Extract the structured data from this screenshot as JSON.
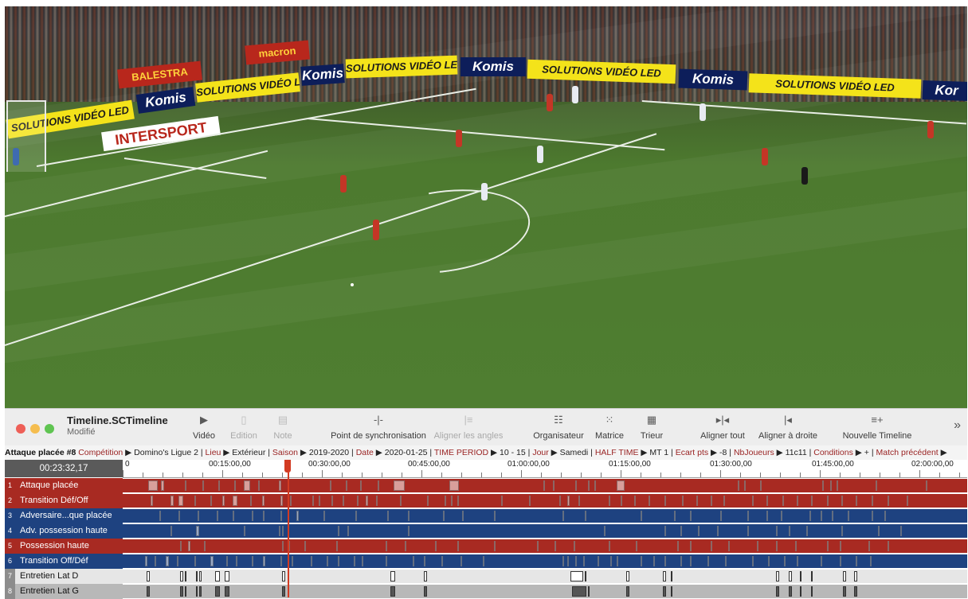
{
  "toolbar": {
    "title": "Timeline.SCTimeline",
    "subtitle": "Modifié",
    "tools": [
      {
        "label": "Vidéo",
        "icon": "video-icon",
        "glyph": "▶",
        "enabled": true
      },
      {
        "label": "Edition",
        "icon": "edit-icon",
        "glyph": "▯",
        "enabled": false
      },
      {
        "label": "Note",
        "icon": "note-icon",
        "glyph": "▤",
        "enabled": false
      },
      {
        "label": "Point de synchronisation",
        "icon": "sync-point-icon",
        "glyph": "-|-",
        "enabled": true
      },
      {
        "label": "Aligner les angles",
        "icon": "align-angles-icon",
        "glyph": "|≡",
        "enabled": false
      },
      {
        "label": "Organisateur",
        "icon": "organizer-icon",
        "glyph": "☷",
        "enabled": true
      },
      {
        "label": "Matrice",
        "icon": "matrix-icon",
        "glyph": "⁙",
        "enabled": true
      },
      {
        "label": "Trieur",
        "icon": "sorter-icon",
        "glyph": "▦",
        "enabled": true
      },
      {
        "label": "Aligner tout",
        "icon": "align-all-icon",
        "glyph": "▸|◂",
        "enabled": true
      },
      {
        "label": "Aligner à droite",
        "icon": "align-right-icon",
        "glyph": "|◂",
        "enabled": true
      },
      {
        "label": "Nouvelle Timeline",
        "icon": "new-timeline-icon",
        "glyph": "≡+",
        "enabled": true
      }
    ],
    "overflow": "»"
  },
  "infobar": {
    "instance": "Attaque placée #8",
    "fields": [
      {
        "key": "Compétition",
        "value": "Domino's Ligue 2"
      },
      {
        "key": "Lieu",
        "value": "Extérieur"
      },
      {
        "key": "Saison",
        "value": "2019-2020"
      },
      {
        "key": "Date",
        "value": "2020-01-25"
      },
      {
        "key": "TIME PERIOD",
        "value": "10 - 15"
      },
      {
        "key": "Jour",
        "value": "Samedi"
      },
      {
        "key": "HALF TIME",
        "value": "MT 1"
      },
      {
        "key": "Ecart pts",
        "value": "-8"
      },
      {
        "key": "NbJoueurs",
        "value": "11c11"
      },
      {
        "key": "Conditions",
        "value": "+"
      },
      {
        "key": "Match précédent",
        "value": ""
      }
    ]
  },
  "timeline": {
    "timecode": "00:23:32,17",
    "ticks": [
      "0",
      "00:15:00,00",
      "00:30:00,00",
      "00:45:00,00",
      "01:00:00,00",
      "01:15:00,00",
      "01:30:00,00",
      "01:45:00,00",
      "02:00:00,00"
    ],
    "playhead_time": "00:23:32,17",
    "rows": [
      {
        "num": "1",
        "label": "Attaque placée",
        "color": "#a82a22"
      },
      {
        "num": "2",
        "label": "Transition Déf/Off",
        "color": "#a82a22"
      },
      {
        "num": "3",
        "label": "Adversaire...que placée",
        "color": "#1e4280"
      },
      {
        "num": "4",
        "label": "Adv. possession haute",
        "color": "#1e4280"
      },
      {
        "num": "5",
        "label": "Possession haute",
        "color": "#a82a22"
      },
      {
        "num": "6",
        "label": "Transition Off/Déf",
        "color": "#1e4280"
      },
      {
        "num": "7",
        "label": "Entretien Lat D",
        "color": "#e6e6e6"
      },
      {
        "num": "8",
        "label": "Entretien Lat G",
        "color": "#b8b8b8"
      }
    ]
  },
  "video": {
    "boards": [
      "SOLUTIONS VIDÉO LED",
      "Komis",
      "SOLUTIONS VIDÉO LED",
      "Komis",
      "SOLUTIONS VIDÉO LED",
      "Komis",
      "SOLUTIONS VIDÉO LED",
      "Komis",
      "SOLUTIONS VIDÉO LED",
      "Kor"
    ],
    "balestra": "BALESTRA",
    "macron": "macron",
    "intersport": "INTERSPORT"
  }
}
